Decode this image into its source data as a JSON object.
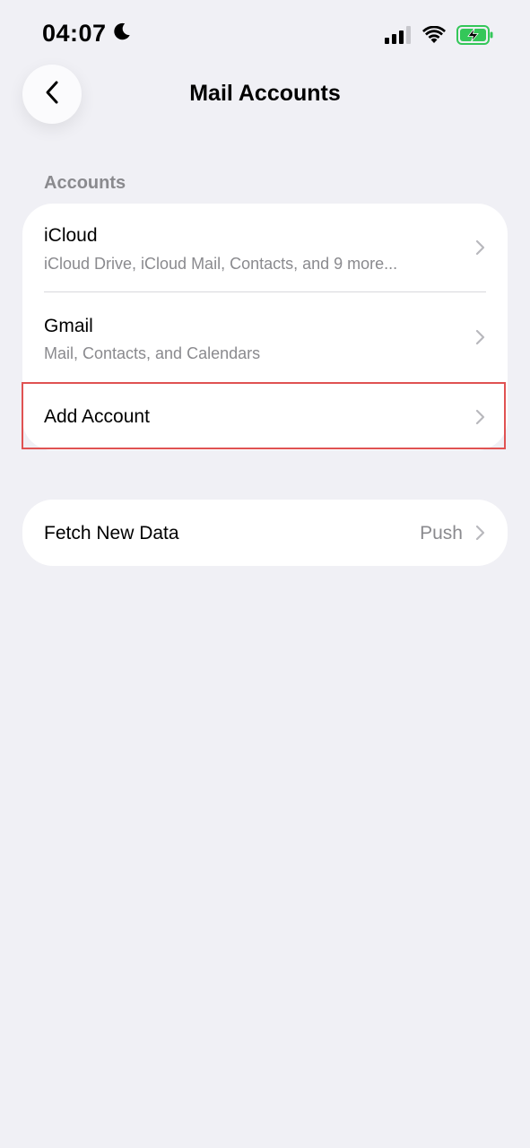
{
  "status_bar": {
    "time": "04:07",
    "icons": [
      "moon-icon",
      "cellular-signal-icon",
      "wifi-icon",
      "battery-charging-icon"
    ],
    "battery_color": "#34c759"
  },
  "nav": {
    "title": "Mail Accounts",
    "back_icon": "chevron-left-icon"
  },
  "accounts_section": {
    "header": "Accounts",
    "items": [
      {
        "title": "iCloud",
        "subtitle": "iCloud Drive, iCloud Mail, Contacts, and 9 more..."
      },
      {
        "title": "Gmail",
        "subtitle": "Mail, Contacts, and Calendars"
      },
      {
        "title": "Add Account"
      }
    ]
  },
  "fetch_section": {
    "title": "Fetch New Data",
    "value": "Push"
  },
  "colors": {
    "background": "#f0f0f5",
    "secondary_text": "#8a8a8e",
    "highlight": "#e05252"
  }
}
